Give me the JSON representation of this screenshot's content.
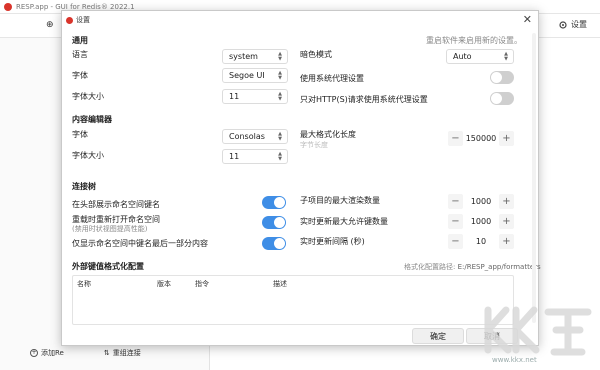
{
  "main_window": {
    "title": "RESP.app - GUI for Redis® 2022.1",
    "toolbar": {
      "add_label": "⊕",
      "settings_label": "设置"
    },
    "bottom": {
      "add_connection": "添加Re",
      "reload": "重组连接"
    }
  },
  "dialog": {
    "title": "设置",
    "sections": {
      "general": {
        "title": "通用",
        "restart_hint": "重启软件来启用新的设置。",
        "language_label": "语言",
        "language_value": "system",
        "font_label": "字体",
        "font_value": "Segoe UI",
        "font_size_label": "字体大小",
        "font_size_value": "11",
        "color_mode_label": "暗色模式",
        "color_mode_value": "Auto",
        "use_system_proxy_label": "使用系统代理设置",
        "use_system_proxy_http_label": "只对HTTP(S)请求使用系统代理设置",
        "use_system_proxy": false,
        "use_system_proxy_http": false
      },
      "editor": {
        "title": "内容编辑器",
        "font_label": "字体",
        "font_value": "Consolas",
        "font_size_label": "字体大小",
        "font_size_value": "11",
        "max_format_len_label": "最大格式化长度",
        "max_format_len_hint": "字节长度",
        "max_format_len_value": "150000"
      },
      "connections": {
        "title": "连接树",
        "show_ns_in_header_label": "在头部展示命名空间键名",
        "reopen_ns_label": "重载时重新打开命名空间",
        "reopen_ns_hint": "(禁用时状视图提高性能)",
        "show_last_part_label": "仅显示命名空间中键名最后一部分内容",
        "show_ns_in_header": true,
        "reopen_ns": true,
        "show_last_part": true,
        "max_children_label": "子项目的最大渲染数量",
        "max_children_value": "1000",
        "live_update_max_label": "实时更新最大允许键数量",
        "live_update_max_value": "1000",
        "live_update_interval_label": "实时更新间隔 (秒)",
        "live_update_interval_value": "10"
      },
      "formatters": {
        "title": "外部键值格式化配置",
        "path_label": "格式化配置路径:",
        "path_value": "E:/RESP_app/formatters",
        "columns": [
          "名称",
          "版本",
          "指令",
          "描述"
        ]
      }
    },
    "buttons": {
      "ok": "确定",
      "cancel": "取消"
    }
  },
  "watermark": {
    "url": "www.kkx.net"
  },
  "colors": {
    "toggle_on": "#3f8ee6",
    "toggle_off": "#cfcfcf",
    "app_red": "#d9342b"
  }
}
